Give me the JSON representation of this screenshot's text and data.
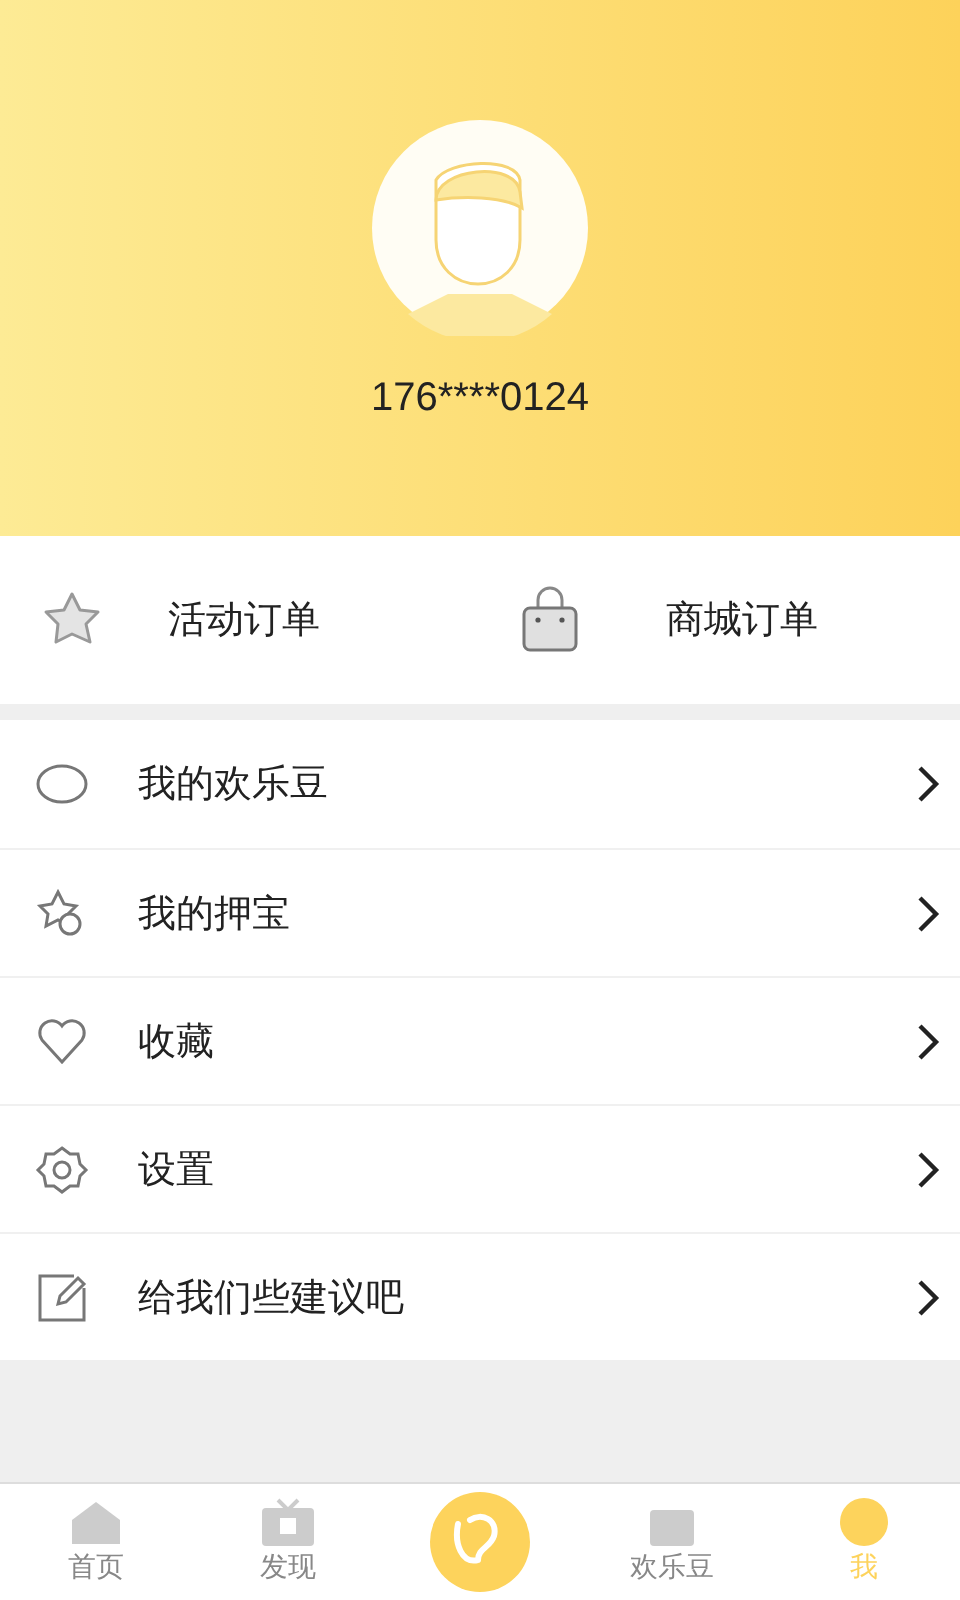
{
  "profile": {
    "phone": "176****0124"
  },
  "orders": [
    {
      "kind": "activity",
      "label": "活动订单"
    },
    {
      "kind": "shop",
      "label": "商城订单"
    }
  ],
  "menu": [
    {
      "kind": "bean",
      "label": "我的欢乐豆"
    },
    {
      "kind": "treasure",
      "label": "我的押宝"
    },
    {
      "kind": "favorite",
      "label": "收藏"
    },
    {
      "kind": "settings",
      "label": "设置"
    },
    {
      "kind": "feedback",
      "label": "给我们些建议吧"
    }
  ],
  "tab_bar": [
    {
      "kind": "home",
      "label": "首页",
      "selected": false
    },
    {
      "kind": "discover",
      "label": "发现",
      "selected": false
    },
    {
      "kind": "logo",
      "selected": false
    },
    {
      "kind": "bean",
      "label": "欢乐豆",
      "selected": false
    },
    {
      "kind": "me",
      "label": "我",
      "selected": true
    }
  ]
}
